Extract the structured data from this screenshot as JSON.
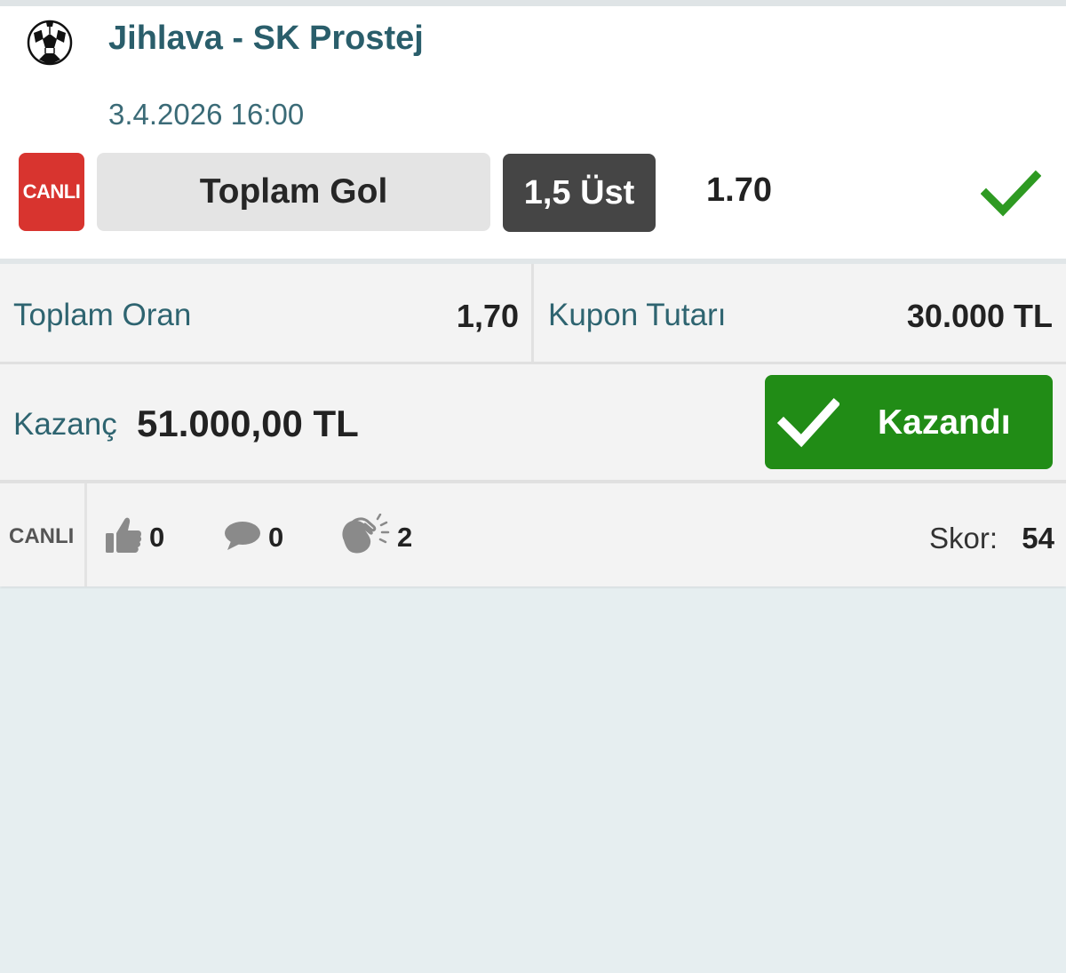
{
  "match": {
    "title": "Jihlava - SK Prostej",
    "datetime": "3.4.2026 16:00",
    "sport_icon": "soccer-ball-icon",
    "live_badge": "CANLI",
    "market": "Toplam Gol",
    "selection": "1,5 Üst",
    "odd": "1.70",
    "status_icon": "check-icon"
  },
  "totals": {
    "total_odd_label": "Toplam Oran",
    "total_odd_value": "1,70",
    "coupon_label": "Kupon Tutarı",
    "coupon_value": "30.000 TL"
  },
  "winnings": {
    "label": "Kazanç",
    "value": "51.000,00 TL",
    "status_button": "Kazandı"
  },
  "social": {
    "live_tag": "CANLI",
    "likes": "0",
    "comments": "0",
    "claps": "2",
    "score_label": "Skor:",
    "score_value": "54"
  },
  "colors": {
    "title": "#2a5e6b",
    "live_red": "#d8342f",
    "selection_dark": "#454545",
    "win_green": "#218c16",
    "check_green": "#2e9a22",
    "background": "#e6eef0"
  }
}
